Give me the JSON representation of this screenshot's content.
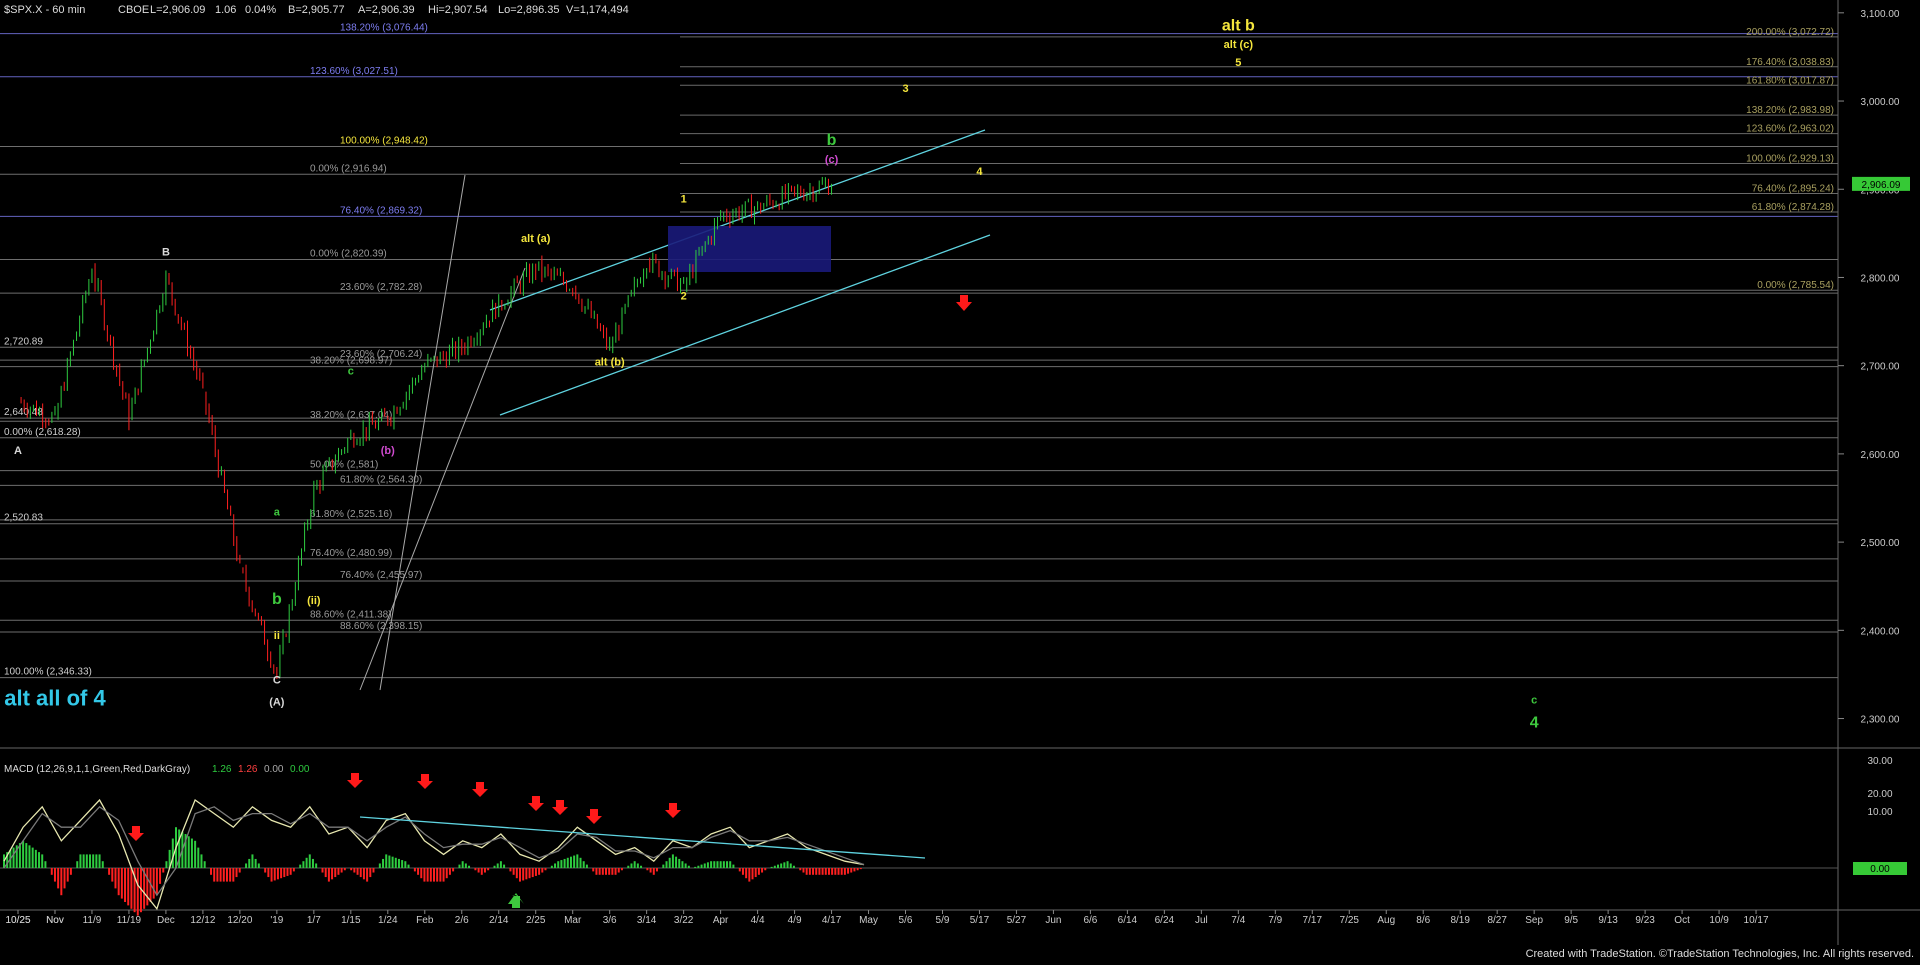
{
  "header": {
    "symbol": "$SPX.X - 60 min",
    "exchange": "CBOE",
    "last": "L=2,906.09",
    "change": "1.06",
    "change_pct": "0.04%",
    "bid": "B=2,905.77",
    "ask": "A=2,906.39",
    "high": "Hi=2,907.54",
    "low": "Lo=2,896.35",
    "volume": "V=1,174,494"
  },
  "footer": {
    "credit": "Created with TradeStation. ©TradeStation Technologies, Inc. All rights reserved."
  },
  "macd": {
    "label": "MACD (12,26,9,1,1,Green,Red,DarkGray)",
    "v1": "1.26",
    "v2": "1.26",
    "v3": "0.00",
    "v4": "0.00",
    "value_badge": "0.00",
    "ticks": [
      "30.00",
      "20.00",
      "10.00",
      "0.00"
    ]
  },
  "colors": {
    "background": "#000000",
    "up_bar": "#2ecc40",
    "down_bar": "#ff2020",
    "channel": "#5fd3e0",
    "fib_line": "#9a9a9a",
    "fib_blue": "#7d7df0",
    "label_yellow": "#f5e63d",
    "label_green": "#3ec93e",
    "label_magenta": "#d04bd0",
    "label_cyan": "#33c8e8",
    "label_white": "#d8d8d8",
    "arrow_red": "#ff1a1a",
    "price_badge": "#36c936"
  },
  "chart_data": {
    "type": "line",
    "title": "$SPX.X - 60 min",
    "xlabel": "",
    "ylabel": "",
    "ylim": [
      2270,
      3110
    ],
    "y_ticks": [
      "3,100.00",
      "3,000.00",
      "2,900.00",
      "2,800.00",
      "2,700.00",
      "2,600.00",
      "2,500.00",
      "2,400.00",
      "2,300.00"
    ],
    "current_price": "2,906.09",
    "x_ticks": [
      "10/25",
      "Nov",
      "11/9",
      "11/19",
      "Dec",
      "12/12",
      "12/20",
      "'19",
      "1/7",
      "1/15",
      "1/24",
      "Feb",
      "2/6",
      "2/14",
      "2/25",
      "Mar",
      "3/6",
      "3/14",
      "3/22",
      "Apr",
      "4/4",
      "4/9",
      "4/17",
      "May",
      "5/6",
      "5/9",
      "5/17",
      "5/27",
      "Jun",
      "6/6",
      "6/14",
      "6/24",
      "Jul",
      "7/4",
      "7/9",
      "7/17",
      "7/25",
      "Aug",
      "8/6",
      "8/19",
      "8/27",
      "Sep",
      "9/5",
      "9/13",
      "9/23",
      "Oct",
      "10/9",
      "10/17",
      "10/25",
      "Nov"
    ],
    "price_path": [
      {
        "x": "10/25",
        "y": 2660
      },
      {
        "x": "Nov",
        "y": 2640
      },
      {
        "x": "11/9",
        "y": 2810
      },
      {
        "x": "11/19",
        "y": 2640
      },
      {
        "x": "Dec",
        "y": 2800
      },
      {
        "x": "12/12",
        "y": 2670
      },
      {
        "x": "12/20",
        "y": 2470
      },
      {
        "x": "'19",
        "y": 2350
      },
      {
        "x": "1/7",
        "y": 2560
      },
      {
        "x": "1/15",
        "y": 2620
      },
      {
        "x": "1/24",
        "y": 2640
      },
      {
        "x": "Feb",
        "y": 2700
      },
      {
        "x": "2/6",
        "y": 2720
      },
      {
        "x": "2/14",
        "y": 2770
      },
      {
        "x": "2/25",
        "y": 2810
      },
      {
        "x": "Mar",
        "y": 2790
      },
      {
        "x": "3/6",
        "y": 2720
      },
      {
        "x": "3/14",
        "y": 2820
      },
      {
        "x": "3/22",
        "y": 2790
      },
      {
        "x": "Apr",
        "y": 2870
      },
      {
        "x": "4/4",
        "y": 2880
      },
      {
        "x": "4/9",
        "y": 2895
      },
      {
        "x": "4/17",
        "y": 2906
      }
    ],
    "fib_levels": [
      {
        "label": "138.20% (3,076.44)",
        "price": 3076.44,
        "kind": "blue"
      },
      {
        "label": "123.60% (3,027.51)",
        "price": 3027.51,
        "kind": "blue"
      },
      {
        "label": "100.00% (2,948.42)",
        "price": 2948.42,
        "kind": "yellow"
      },
      {
        "label": "0.00% (2,916.94)",
        "price": 2916.94,
        "kind": "gray"
      },
      {
        "label": "76.40% (2,869.32)",
        "price": 2869.32,
        "kind": "blue"
      },
      {
        "label": "0.00% (2,820.39)",
        "price": 2820.39,
        "kind": "gray"
      },
      {
        "label": "23.60% (2,782.28)",
        "price": 2782.28,
        "kind": "gray"
      },
      {
        "label": "2,720.89",
        "price": 2720.89,
        "kind": "white"
      },
      {
        "label": "23.60% (2,706.24)",
        "price": 2706.24,
        "kind": "gray"
      },
      {
        "label": "38.20% (2,698.97)",
        "price": 2698.97,
        "kind": "gray"
      },
      {
        "label": "2,640.48",
        "price": 2640.48,
        "kind": "white"
      },
      {
        "label": "38.20% (2,637.04)",
        "price": 2637.04,
        "kind": "gray"
      },
      {
        "label": "0.00% (2,618.28)",
        "price": 2618.28,
        "kind": "white"
      },
      {
        "label": "50.00% (2,581)",
        "price": 2581,
        "kind": "gray"
      },
      {
        "label": "61.80% (2,564.30)",
        "price": 2564.3,
        "kind": "gray"
      },
      {
        "label": "61.80% (2,525.16)",
        "price": 2525.16,
        "kind": "gray"
      },
      {
        "label": "2,520.83",
        "price": 2520.83,
        "kind": "white"
      },
      {
        "label": "76.40% (2,480.99)",
        "price": 2480.99,
        "kind": "gray"
      },
      {
        "label": "76.40% (2,455.97)",
        "price": 2455.97,
        "kind": "gray"
      },
      {
        "label": "88.60% (2,411.38)",
        "price": 2411.38,
        "kind": "gray"
      },
      {
        "label": "88.60% (2,398.15)",
        "price": 2398.15,
        "kind": "gray"
      },
      {
        "label": "100.00% (2,346.33)",
        "price": 2346.33,
        "kind": "white"
      }
    ],
    "right_fibs": [
      {
        "label": "200.00% (3,072.72)",
        "price": 3072.72
      },
      {
        "label": "176.40% (3,038.83)",
        "price": 3038.83
      },
      {
        "label": "161.80% (3,017.87)",
        "price": 3017.87
      },
      {
        "label": "138.20% (2,983.98)",
        "price": 2983.98
      },
      {
        "label": "123.60% (2,963.02)",
        "price": 2963.02
      },
      {
        "label": "100.00% (2,929.13)",
        "price": 2929.13
      },
      {
        "label": "76.40% (2,895.24)",
        "price": 2895.24
      },
      {
        "label": "61.80% (2,874.28)",
        "price": 2874.28
      },
      {
        "label": "0.00% (2,785.54)",
        "price": 2785.54
      }
    ],
    "wave_labels": [
      {
        "text": "alt b",
        "color": "yellow",
        "x": "7/4",
        "y": 3080
      },
      {
        "text": "alt (c)",
        "color": "yellow",
        "x": "7/4",
        "y": 3060
      },
      {
        "text": "5",
        "color": "yellow",
        "x": "7/4",
        "y": 3040
      },
      {
        "text": "3",
        "color": "yellow",
        "x": "5/6",
        "y": 3010
      },
      {
        "text": "b",
        "color": "green",
        "x": "4/17",
        "y": 2950
      },
      {
        "text": "(c)",
        "color": "magenta",
        "x": "4/17",
        "y": 2930
      },
      {
        "text": "4",
        "color": "yellow",
        "x": "5/17",
        "y": 2916
      },
      {
        "text": "1",
        "color": "yellow",
        "x": "3/22",
        "y": 2885
      },
      {
        "text": "alt (a)",
        "color": "yellow",
        "x": "2/25",
        "y": 2840
      },
      {
        "text": "2",
        "color": "yellow",
        "x": "3/22",
        "y": 2775
      },
      {
        "text": "alt (b)",
        "color": "yellow",
        "x": "3/6",
        "y": 2700
      },
      {
        "text": "B",
        "color": "white",
        "x": "Dec",
        "y": 2825
      },
      {
        "text": "A",
        "color": "white",
        "x": "10/25",
        "y": 2600
      },
      {
        "text": "c",
        "color": "green",
        "x": "1/15",
        "y": 2690
      },
      {
        "text": "(b)",
        "color": "magenta",
        "x": "1/24",
        "y": 2600
      },
      {
        "text": "a",
        "color": "green",
        "x": "'19",
        "y": 2530
      },
      {
        "text": "b",
        "color": "green",
        "x": "'19",
        "y": 2430
      },
      {
        "text": "(ii)",
        "color": "yellow",
        "x": "1/7",
        "y": 2430
      },
      {
        "text": "ii",
        "color": "yellow",
        "x": "'19",
        "y": 2390
      },
      {
        "text": "C",
        "color": "white",
        "x": "'19",
        "y": 2340
      },
      {
        "text": "alt all of 4",
        "color": "cyan",
        "x": "Nov",
        "y": 2315
      },
      {
        "text": "(A)",
        "color": "white",
        "x": "'19",
        "y": 2315
      },
      {
        "text": "c",
        "color": "green",
        "x": "Sep",
        "y": 2317
      },
      {
        "text": "4",
        "color": "green",
        "x": "Sep",
        "y": 2290
      }
    ],
    "macd_series": [
      {
        "name": "MACD",
        "values": [
          2,
          12,
          18,
          8,
          14,
          20,
          10,
          -5,
          -12,
          6,
          20,
          16,
          12,
          18,
          14,
          12,
          18,
          10,
          12,
          6,
          14,
          16,
          8,
          4,
          8,
          6,
          10,
          4,
          2,
          6,
          12,
          8,
          4,
          6,
          2,
          8,
          6,
          10,
          12,
          6,
          8,
          10,
          6,
          4,
          2,
          1
        ]
      },
      {
        "name": "Signal",
        "values": [
          0,
          8,
          16,
          12,
          12,
          18,
          14,
          2,
          -8,
          0,
          16,
          18,
          14,
          16,
          16,
          13,
          16,
          12,
          12,
          8,
          12,
          15,
          10,
          6,
          7,
          7,
          9,
          6,
          3,
          5,
          10,
          9,
          5,
          5,
          3,
          6,
          6,
          9,
          11,
          8,
          8,
          9,
          7,
          5,
          3,
          1
        ]
      }
    ]
  }
}
